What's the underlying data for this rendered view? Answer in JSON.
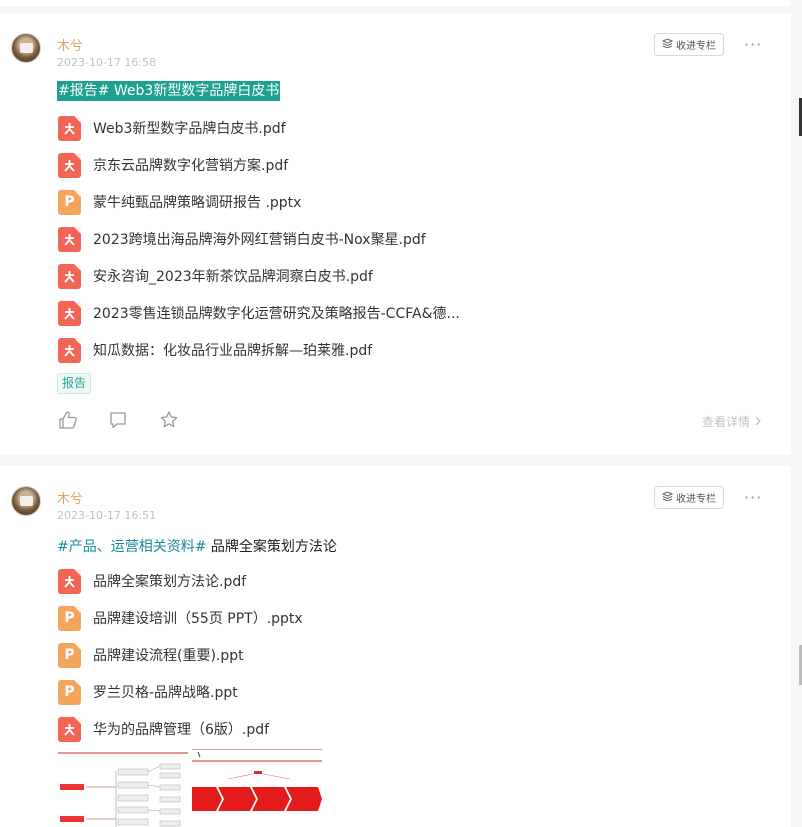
{
  "posts": [
    {
      "author": "木兮",
      "date": "2023-10-17 16:58",
      "subscribe_label": "收进专栏",
      "more_label": "···",
      "title_highlight": "#报告# Web3新型数字品牌白皮书",
      "files": [
        {
          "type": "pdf",
          "name": "Web3新型数字品牌白皮书.pdf"
        },
        {
          "type": "pdf",
          "name": "京东云品牌数字化营销方案.pdf"
        },
        {
          "type": "ppt",
          "name": "蒙牛纯甄品牌策略调研报告 .pptx"
        },
        {
          "type": "pdf",
          "name": "2023跨境出海品牌海外网红营销白皮书-Nox聚星.pdf"
        },
        {
          "type": "pdf",
          "name": "安永咨询_2023年新茶饮品牌洞察白皮书.pdf"
        },
        {
          "type": "pdf",
          "name": "2023零售连锁品牌数字化运营研究及策略报告-CCFA&德..."
        },
        {
          "type": "pdf",
          "name": "知瓜数据：化妆品行业品牌拆解—珀莱雅.pdf"
        }
      ],
      "tag": "报告",
      "detail_label": "查看详情"
    },
    {
      "author": "木兮",
      "date": "2023-10-17 16:51",
      "subscribe_label": "收进专栏",
      "more_label": "···",
      "hashtag": "#产品、运营相关资料#",
      "title_text": "品牌全案策划方法论",
      "files": [
        {
          "type": "pdf",
          "name": "品牌全案策划方法论.pdf"
        },
        {
          "type": "ppt",
          "name": "品牌建设培训（55页 PPT）.pptx"
        },
        {
          "type": "ppt",
          "name": "品牌建设流程(重要).ppt"
        },
        {
          "type": "ppt",
          "name": "罗兰贝格-品牌战略.ppt"
        },
        {
          "type": "pdf",
          "name": "华为的品牌管理（6版）.pdf"
        }
      ]
    }
  ],
  "icons": {
    "pdf_glyph": "⅄",
    "ppt_glyph": "P"
  },
  "colors": {
    "author": "#e0a566",
    "highlight": "#1ea18f",
    "pdf": "#f06556",
    "ppt": "#f2a55b",
    "tag": "#29a593"
  }
}
